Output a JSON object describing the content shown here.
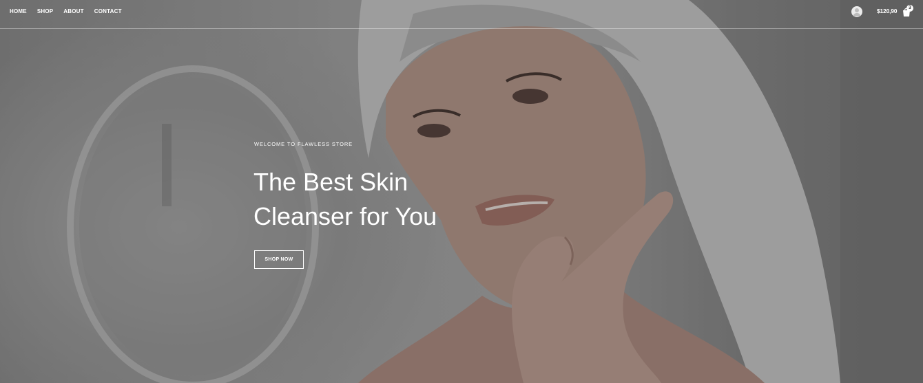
{
  "nav": {
    "items": [
      {
        "label": "HOME"
      },
      {
        "label": "SHOP"
      },
      {
        "label": "ABOUT"
      },
      {
        "label": "CONTACT"
      }
    ]
  },
  "header": {
    "account_icon": "user-avatar-icon",
    "cart_total": "$120,90",
    "cart_icon": "shopping-bag-icon",
    "cart_count": "3"
  },
  "hero": {
    "eyebrow": "WELCOME TO FLAWLESS STORE",
    "headline_line1": "The Best Skin",
    "headline_line2": "Cleanser for You",
    "cta_label": "SHOP NOW"
  }
}
